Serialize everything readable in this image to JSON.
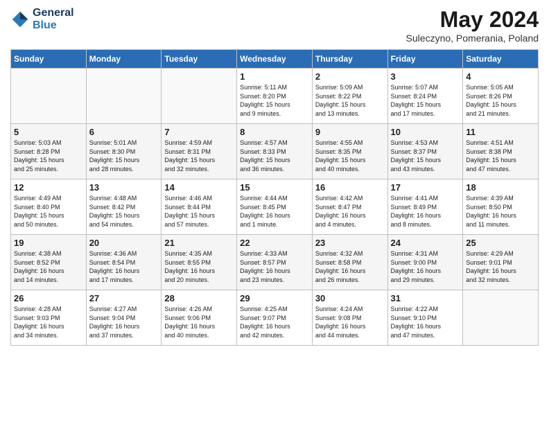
{
  "header": {
    "logo_line1": "General",
    "logo_line2": "Blue",
    "main_title": "May 2024",
    "subtitle": "Suleczyno, Pomerania, Poland"
  },
  "days_of_week": [
    "Sunday",
    "Monday",
    "Tuesday",
    "Wednesday",
    "Thursday",
    "Friday",
    "Saturday"
  ],
  "weeks": [
    [
      {
        "num": "",
        "info": ""
      },
      {
        "num": "",
        "info": ""
      },
      {
        "num": "",
        "info": ""
      },
      {
        "num": "1",
        "info": "Sunrise: 5:11 AM\nSunset: 8:20 PM\nDaylight: 15 hours\nand 9 minutes."
      },
      {
        "num": "2",
        "info": "Sunrise: 5:09 AM\nSunset: 8:22 PM\nDaylight: 15 hours\nand 13 minutes."
      },
      {
        "num": "3",
        "info": "Sunrise: 5:07 AM\nSunset: 8:24 PM\nDaylight: 15 hours\nand 17 minutes."
      },
      {
        "num": "4",
        "info": "Sunrise: 5:05 AM\nSunset: 8:26 PM\nDaylight: 15 hours\nand 21 minutes."
      }
    ],
    [
      {
        "num": "5",
        "info": "Sunrise: 5:03 AM\nSunset: 8:28 PM\nDaylight: 15 hours\nand 25 minutes."
      },
      {
        "num": "6",
        "info": "Sunrise: 5:01 AM\nSunset: 8:30 PM\nDaylight: 15 hours\nand 28 minutes."
      },
      {
        "num": "7",
        "info": "Sunrise: 4:59 AM\nSunset: 8:31 PM\nDaylight: 15 hours\nand 32 minutes."
      },
      {
        "num": "8",
        "info": "Sunrise: 4:57 AM\nSunset: 8:33 PM\nDaylight: 15 hours\nand 36 minutes."
      },
      {
        "num": "9",
        "info": "Sunrise: 4:55 AM\nSunset: 8:35 PM\nDaylight: 15 hours\nand 40 minutes."
      },
      {
        "num": "10",
        "info": "Sunrise: 4:53 AM\nSunset: 8:37 PM\nDaylight: 15 hours\nand 43 minutes."
      },
      {
        "num": "11",
        "info": "Sunrise: 4:51 AM\nSunset: 8:38 PM\nDaylight: 15 hours\nand 47 minutes."
      }
    ],
    [
      {
        "num": "12",
        "info": "Sunrise: 4:49 AM\nSunset: 8:40 PM\nDaylight: 15 hours\nand 50 minutes."
      },
      {
        "num": "13",
        "info": "Sunrise: 4:48 AM\nSunset: 8:42 PM\nDaylight: 15 hours\nand 54 minutes."
      },
      {
        "num": "14",
        "info": "Sunrise: 4:46 AM\nSunset: 8:44 PM\nDaylight: 15 hours\nand 57 minutes."
      },
      {
        "num": "15",
        "info": "Sunrise: 4:44 AM\nSunset: 8:45 PM\nDaylight: 16 hours\nand 1 minute."
      },
      {
        "num": "16",
        "info": "Sunrise: 4:42 AM\nSunset: 8:47 PM\nDaylight: 16 hours\nand 4 minutes."
      },
      {
        "num": "17",
        "info": "Sunrise: 4:41 AM\nSunset: 8:49 PM\nDaylight: 16 hours\nand 8 minutes."
      },
      {
        "num": "18",
        "info": "Sunrise: 4:39 AM\nSunset: 8:50 PM\nDaylight: 16 hours\nand 11 minutes."
      }
    ],
    [
      {
        "num": "19",
        "info": "Sunrise: 4:38 AM\nSunset: 8:52 PM\nDaylight: 16 hours\nand 14 minutes."
      },
      {
        "num": "20",
        "info": "Sunrise: 4:36 AM\nSunset: 8:54 PM\nDaylight: 16 hours\nand 17 minutes."
      },
      {
        "num": "21",
        "info": "Sunrise: 4:35 AM\nSunset: 8:55 PM\nDaylight: 16 hours\nand 20 minutes."
      },
      {
        "num": "22",
        "info": "Sunrise: 4:33 AM\nSunset: 8:57 PM\nDaylight: 16 hours\nand 23 minutes."
      },
      {
        "num": "23",
        "info": "Sunrise: 4:32 AM\nSunset: 8:58 PM\nDaylight: 16 hours\nand 26 minutes."
      },
      {
        "num": "24",
        "info": "Sunrise: 4:31 AM\nSunset: 9:00 PM\nDaylight: 16 hours\nand 29 minutes."
      },
      {
        "num": "25",
        "info": "Sunrise: 4:29 AM\nSunset: 9:01 PM\nDaylight: 16 hours\nand 32 minutes."
      }
    ],
    [
      {
        "num": "26",
        "info": "Sunrise: 4:28 AM\nSunset: 9:03 PM\nDaylight: 16 hours\nand 34 minutes."
      },
      {
        "num": "27",
        "info": "Sunrise: 4:27 AM\nSunset: 9:04 PM\nDaylight: 16 hours\nand 37 minutes."
      },
      {
        "num": "28",
        "info": "Sunrise: 4:26 AM\nSunset: 9:06 PM\nDaylight: 16 hours\nand 40 minutes."
      },
      {
        "num": "29",
        "info": "Sunrise: 4:25 AM\nSunset: 9:07 PM\nDaylight: 16 hours\nand 42 minutes."
      },
      {
        "num": "30",
        "info": "Sunrise: 4:24 AM\nSunset: 9:08 PM\nDaylight: 16 hours\nand 44 minutes."
      },
      {
        "num": "31",
        "info": "Sunrise: 4:22 AM\nSunset: 9:10 PM\nDaylight: 16 hours\nand 47 minutes."
      },
      {
        "num": "",
        "info": ""
      }
    ]
  ]
}
